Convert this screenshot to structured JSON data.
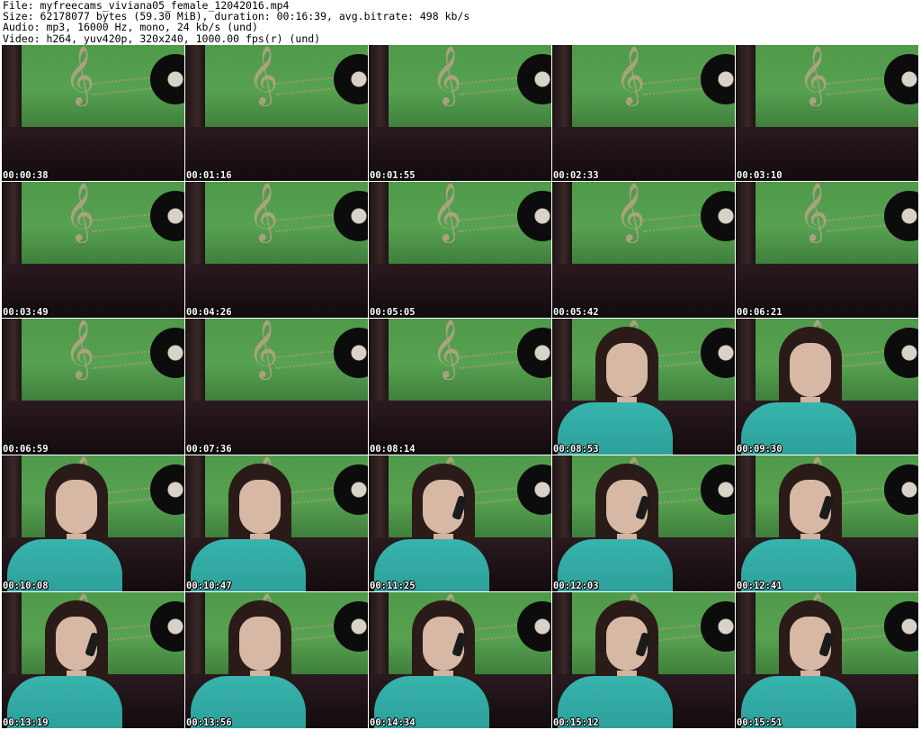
{
  "header": {
    "file_line": "File: myfreecams_viviana05_female_12042016.mp4",
    "size_line": "Size: 62178077 bytes (59.30 MiB), duration: 00:16:39, avg.bitrate: 498 kb/s",
    "audio_line": "Audio: mp3, 16000 Hz, mono, 24 kb/s (und)",
    "video_line": "Video: h264, yuv420p, 320x240, 1000.00 fps(r) (und)"
  },
  "thumbnails": [
    {
      "timestamp": "00:00:38"
    },
    {
      "timestamp": "00:01:16"
    },
    {
      "timestamp": "00:01:55"
    },
    {
      "timestamp": "00:02:33"
    },
    {
      "timestamp": "00:03:10"
    },
    {
      "timestamp": "00:03:49"
    },
    {
      "timestamp": "00:04:26"
    },
    {
      "timestamp": "00:05:05"
    },
    {
      "timestamp": "00:05:42"
    },
    {
      "timestamp": "00:06:21"
    },
    {
      "timestamp": "00:06:59"
    },
    {
      "timestamp": "00:07:36"
    },
    {
      "timestamp": "00:08:14"
    },
    {
      "timestamp": "00:08:53"
    },
    {
      "timestamp": "00:09:30"
    },
    {
      "timestamp": "00:10:08"
    },
    {
      "timestamp": "00:10:47"
    },
    {
      "timestamp": "00:11:25"
    },
    {
      "timestamp": "00:12:03"
    },
    {
      "timestamp": "00:12:41"
    },
    {
      "timestamp": "00:13:19"
    },
    {
      "timestamp": "00:13:56"
    },
    {
      "timestamp": "00:14:34"
    },
    {
      "timestamp": "00:15:12"
    },
    {
      "timestamp": "00:15:51"
    }
  ]
}
